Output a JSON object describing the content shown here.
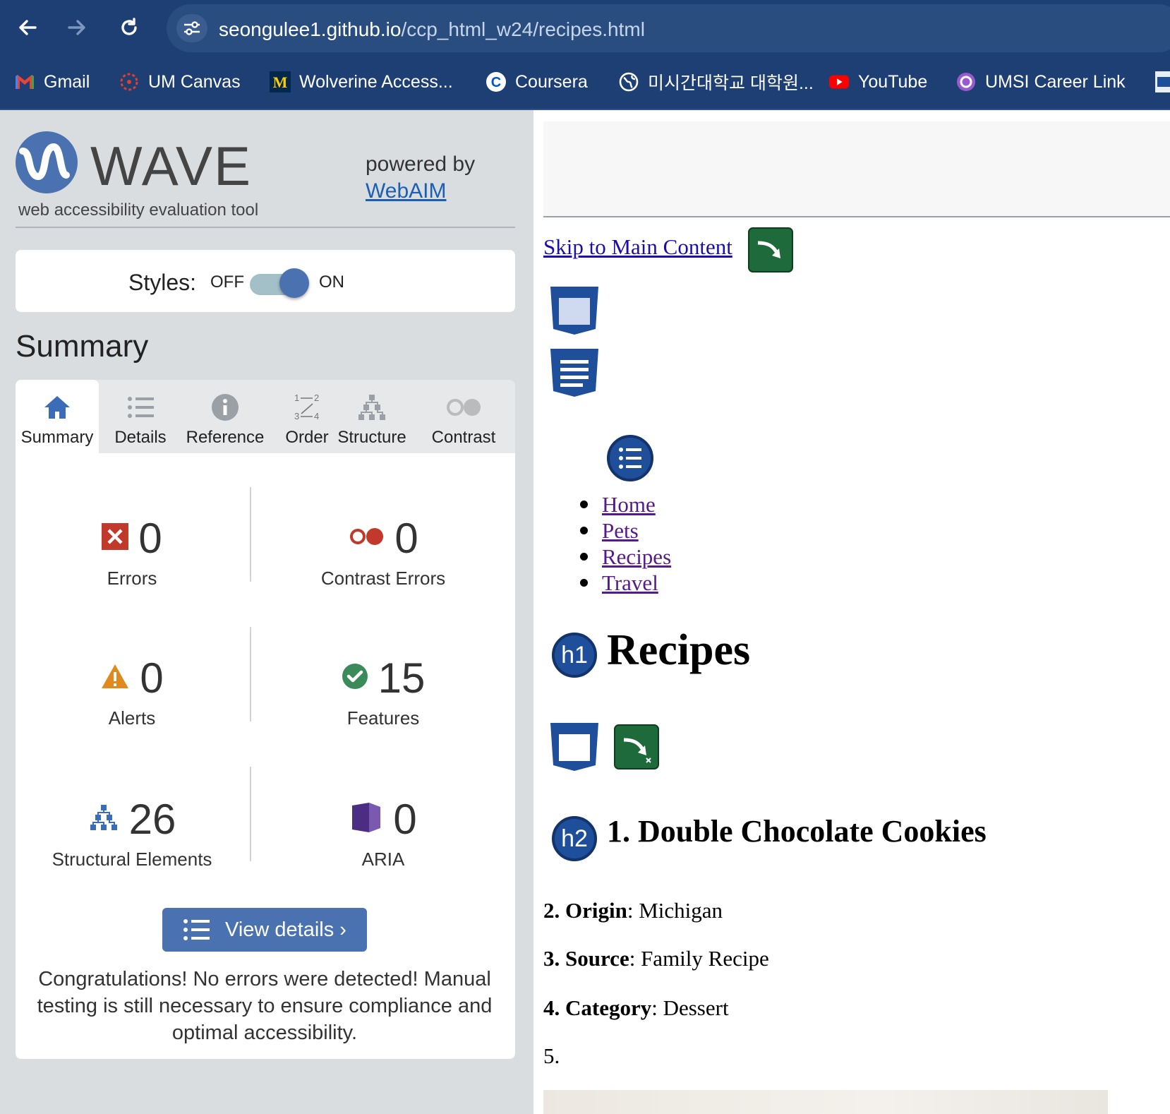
{
  "browser": {
    "url_host": "seongulee1.github.io",
    "url_path": "/ccp_html_w24/recipes.html",
    "bookmarks": [
      {
        "label": "Gmail",
        "icon": "gmail-icon"
      },
      {
        "label": "UM Canvas",
        "icon": "canvas-icon"
      },
      {
        "label": "Wolverine Access...",
        "icon": "michigan-m-icon"
      },
      {
        "label": "Coursera",
        "icon": "coursera-icon"
      },
      {
        "label": "미시간대학교 대학원...",
        "icon": "globe-icon"
      },
      {
        "label": "YouTube",
        "icon": "youtube-icon"
      },
      {
        "label": "UMSI Career Link",
        "icon": "career-link-icon"
      }
    ]
  },
  "wave": {
    "logo_word": "WAVE",
    "tagline": "web accessibility evaluation tool",
    "powered_by": "powered by",
    "webaim": "WebAIM",
    "styles_label": "Styles:",
    "toggle_off": "OFF",
    "toggle_on": "ON",
    "summary_heading": "Summary",
    "tabs": [
      {
        "label": "Summary",
        "icon": "home-icon",
        "active": true
      },
      {
        "label": "Details",
        "icon": "list-icon"
      },
      {
        "label": "Reference",
        "icon": "info-icon"
      },
      {
        "label": "Order",
        "icon": "order-icon"
      },
      {
        "label": "Structure",
        "icon": "structure-icon"
      },
      {
        "label": "Contrast",
        "icon": "contrast-icon"
      }
    ],
    "stats": {
      "errors": {
        "count": "0",
        "label": "Errors"
      },
      "contrast_errors": {
        "count": "0",
        "label": "Contrast Errors"
      },
      "alerts": {
        "count": "0",
        "label": "Alerts"
      },
      "features": {
        "count": "15",
        "label": "Features"
      },
      "structural": {
        "count": "26",
        "label": "Structural Elements"
      },
      "aria": {
        "count": "0",
        "label": "ARIA"
      }
    },
    "view_details": "View details ›",
    "congrats": "Congratulations! No errors were detected! Manual testing is still necessary to ensure compliance and optimal accessibility.",
    "colors": {
      "accent": "#4a72b0",
      "error": "#c0392b",
      "alert": "#e08a1e",
      "feature": "#3a8a5a",
      "aria": "#4b2e83"
    }
  },
  "page": {
    "skip_link": "Skip to Main Content",
    "nav": [
      "Home",
      "Pets",
      "Recipes",
      "Travel"
    ],
    "h1_badge": "h1",
    "h1": "Recipes",
    "h2_badge": "h2",
    "h2": "1. Double Chocolate Cookies",
    "details": [
      {
        "key": "2. Origin",
        "value": ": Michigan"
      },
      {
        "key": "3. Source",
        "value": ": Family Recipe"
      },
      {
        "key": "4. Category",
        "value": ": Dessert"
      }
    ],
    "item5": "5."
  }
}
